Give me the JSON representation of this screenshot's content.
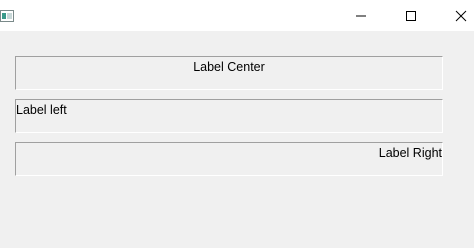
{
  "window": {
    "title": "",
    "controls": {
      "minimize_icon": "minimize-icon",
      "maximize_icon": "maximize-icon",
      "close_icon": "close-icon"
    }
  },
  "labels": {
    "center": "Label Center",
    "left": "Label left",
    "right": "Label Right"
  },
  "colors": {
    "window_bg": "#f0f0f0",
    "titlebar_bg": "#ffffff",
    "border_dark": "#a0a0a0",
    "border_light": "#ffffff"
  }
}
